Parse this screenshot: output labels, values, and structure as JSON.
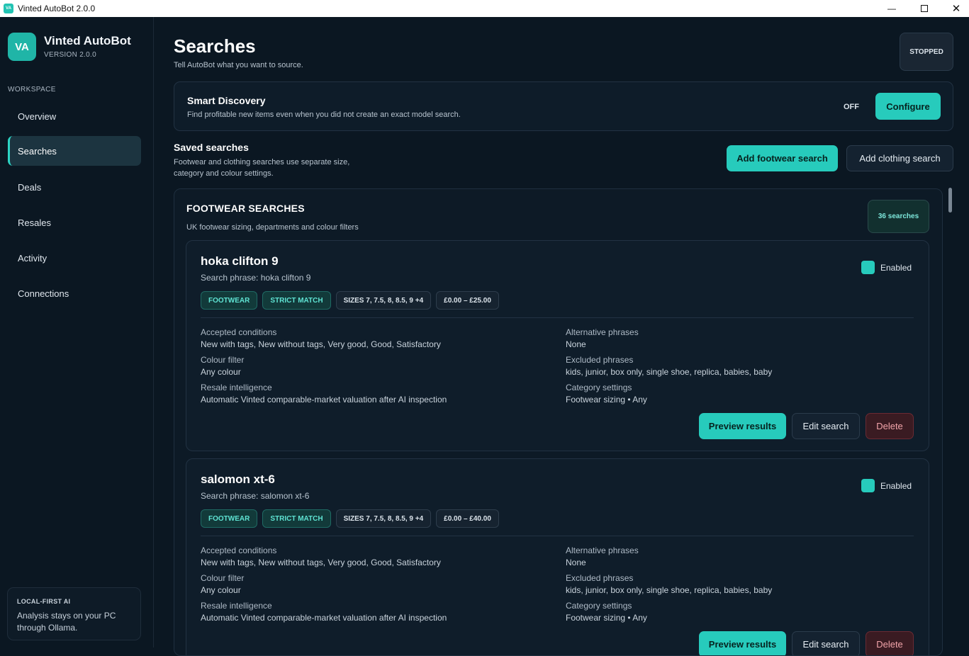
{
  "window": {
    "title": "Vinted AutoBot 2.0.0",
    "icon_text": "VA"
  },
  "sidebar": {
    "logo": "VA",
    "brand": "Vinted AutoBot",
    "version": "VERSION 2.0.0",
    "section": "WORKSPACE",
    "items": [
      {
        "label": "Overview"
      },
      {
        "label": "Searches"
      },
      {
        "label": "Deals"
      },
      {
        "label": "Resales"
      },
      {
        "label": "Activity"
      },
      {
        "label": "Connections"
      }
    ],
    "active_item": "Searches",
    "local": {
      "title": "LOCAL-FIRST AI",
      "desc": "Analysis stays on your PC through Ollama."
    }
  },
  "header": {
    "title": "Searches",
    "subtitle": "Tell AutoBot what you want to source.",
    "status": "STOPPED"
  },
  "smart_discovery": {
    "title": "Smart Discovery",
    "desc": "Find profitable new items even when you did not create an exact model search.",
    "state": "OFF",
    "configure": "Configure"
  },
  "saved": {
    "title": "Saved searches",
    "desc": "Footwear and clothing searches use separate size, category and colour settings.",
    "add_footwear": "Add footwear search",
    "add_clothing": "Add clothing search"
  },
  "footwear": {
    "title": "FOOTWEAR SEARCHES",
    "desc": "UK footwear sizing, departments and colour filters",
    "count": "36 searches",
    "cards": [
      {
        "name": "hoka clifton 9",
        "phrase": "Search phrase: hoka clifton 9",
        "enabled": "Enabled",
        "chips": [
          "FOOTWEAR",
          "STRICT MATCH",
          "SIZES 7, 7.5, 8, 8.5, 9 +4",
          "£0.00 – £25.00"
        ],
        "fields": {
          "cond_label": "Accepted conditions",
          "cond": "New with tags, New without tags, Very good, Good, Satisfactory",
          "colour_label": "Colour filter",
          "colour": "Any colour",
          "resale_label": "Resale intelligence",
          "resale": "Automatic Vinted comparable-market valuation after AI inspection",
          "alt_label": "Alternative phrases",
          "alt": "None",
          "excl_label": "Excluded phrases",
          "excl": "kids, junior, box only, single shoe, replica, babies, baby",
          "cat_label": "Category settings",
          "cat": "Footwear sizing • Any"
        },
        "preview": "Preview results",
        "edit": "Edit search",
        "delete": "Delete"
      },
      {
        "name": "salomon xt-6",
        "phrase": "Search phrase: salomon xt-6",
        "enabled": "Enabled",
        "chips": [
          "FOOTWEAR",
          "STRICT MATCH",
          "SIZES 7, 7.5, 8, 8.5, 9 +4",
          "£0.00 – £40.00"
        ],
        "fields": {
          "cond_label": "Accepted conditions",
          "cond": "New with tags, New without tags, Very good, Good, Satisfactory",
          "colour_label": "Colour filter",
          "colour": "Any colour",
          "resale_label": "Resale intelligence",
          "resale": "Automatic Vinted comparable-market valuation after AI inspection",
          "alt_label": "Alternative phrases",
          "alt": "None",
          "excl_label": "Excluded phrases",
          "excl": "kids, junior, box only, single shoe, replica, babies, baby",
          "cat_label": "Category settings",
          "cat": "Footwear sizing • Any"
        },
        "preview": "Preview results",
        "edit": "Edit search",
        "delete": "Delete"
      }
    ]
  }
}
